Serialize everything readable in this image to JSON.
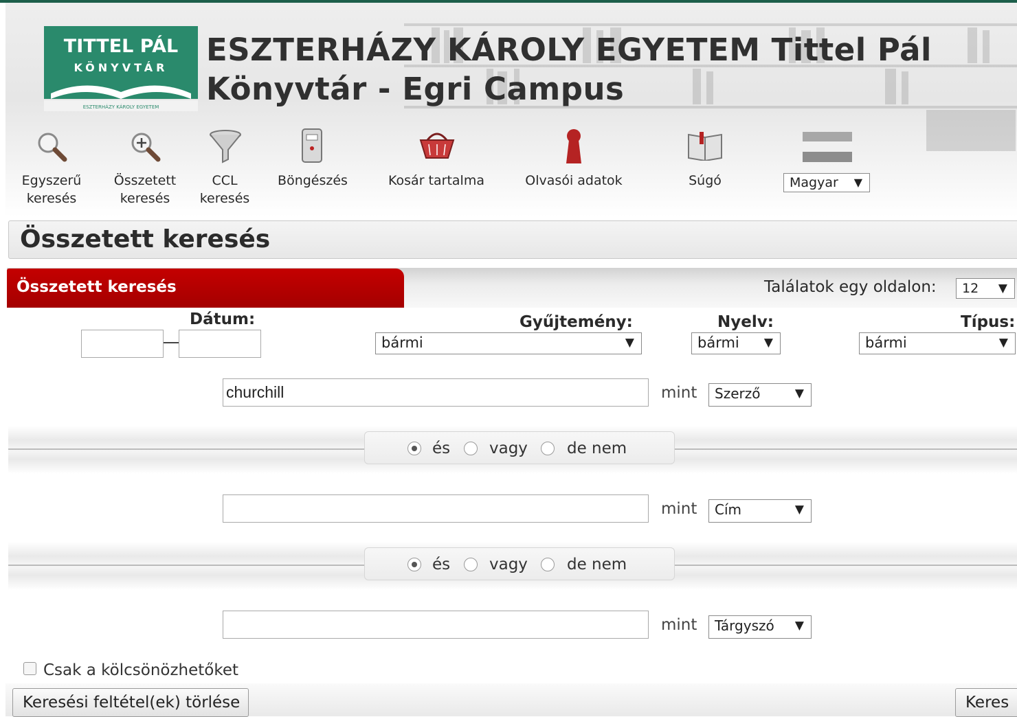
{
  "header": {
    "logo": {
      "line1": "TITTEL PÁL",
      "line2": "KÖNYVTÁR",
      "line3": "ESZTERHÁZY KÁROLY EGYETEM"
    },
    "title_line1": "ESZTERHÁZY KÁROLY EGYETEM Tittel Pál",
    "title_line2": "Könyvtár - Egri Campus"
  },
  "nav": {
    "simple_search": [
      "Egyszerű",
      "keresés"
    ],
    "advanced_search": [
      "Összetett",
      "keresés"
    ],
    "ccl_search": [
      "CCL",
      "keresés"
    ],
    "browse": "Böngészés",
    "basket": "Kosár tartalma",
    "reader_data": "Olvasói adatok",
    "help": "Súgó",
    "language": "Magyar"
  },
  "page": {
    "title": "Összetett keresés"
  },
  "form": {
    "tab_label": "Összetett keresés",
    "hits_per_page_label": "Találatok egy oldalon:",
    "hits_per_page_value": "12",
    "date_label": "Dátum:",
    "date_from": "",
    "date_to": "",
    "collection_label": "Gyűjtemény:",
    "collection_value": "bármi",
    "language_label": "Nyelv:",
    "language_value": "bármi",
    "type_label": "Típus:",
    "type_value": "bármi",
    "mint": "mint",
    "rows": [
      {
        "value": "churchill",
        "field": "Szerző"
      },
      {
        "value": "",
        "field": "Cím"
      },
      {
        "value": "",
        "field": "Tárgyszó"
      }
    ],
    "operators": {
      "and": "és",
      "or": "vagy",
      "not": "de nem",
      "selected": "és"
    },
    "loanable_only_label": "Csak a kölcsönözhetőket",
    "clear_button": "Keresési feltétel(ek) törlése",
    "search_button": "Keres"
  },
  "colors": {
    "brand_green": "#2a8a6c",
    "tab_red": "#b30000"
  }
}
